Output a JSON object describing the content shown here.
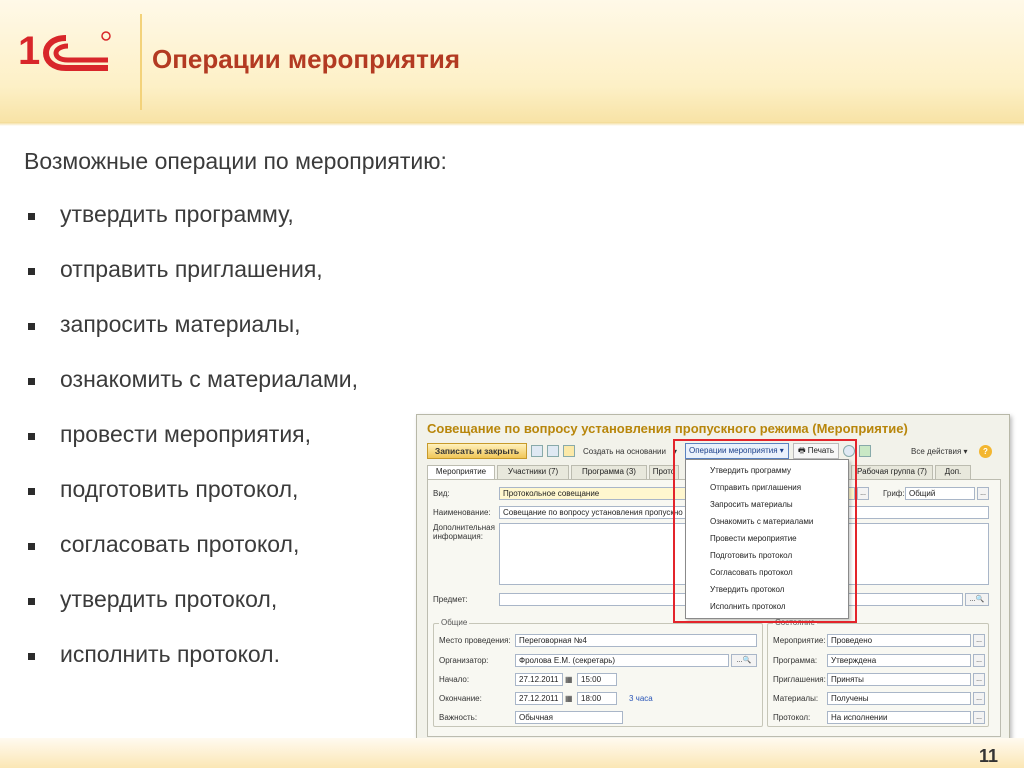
{
  "slide": {
    "logo_text": "1С",
    "title": "Операции мероприятия",
    "intro": "Возможные операции по мероприятию:",
    "bullets": [
      "утвердить программу,",
      "отправить приглашения,",
      "запросить материалы,",
      "ознакомить с материалами,",
      "провести мероприятия,",
      "подготовить протокол,",
      "согласовать протокол,",
      "утвердить протокол,",
      "исполнить протокол."
    ],
    "page_number": "11"
  },
  "screenshot": {
    "window_title": "Совещание по вопросу установления пропускного режима (Мероприятие)",
    "toolbar": {
      "save_close": "Записать и закрыть",
      "create_based": "Создать на основании",
      "operations": "Операции мероприятия",
      "print": "Печать",
      "all_actions": "Все действия",
      "help": "?"
    },
    "tabs": [
      "Мероприятие",
      "Участники (7)",
      "Программа (3)",
      "Прото",
      "Рабочая группа (7)",
      "Доп."
    ],
    "fields": {
      "kind_label": "Вид:",
      "kind_value": "Протокольное совещание",
      "name_label": "Наименование:",
      "name_value": "Совещание по вопросу установления пропускно",
      "extra_label": "Дополнительная информация:",
      "grif_label": "Гриф:",
      "grif_value": "Общий",
      "subject_label": "Предмет:"
    },
    "general": {
      "title": "Общие",
      "place_label": "Место проведения:",
      "place_value": "Переговорная №4",
      "organizer_label": "Организатор:",
      "organizer_value": "Фролова Е.М. (секретарь)",
      "start_label": "Начало:",
      "start_date": "27.12.2011",
      "start_time": "15:00",
      "end_label": "Окончание:",
      "end_date": "27.12.2011",
      "end_time": "18:00",
      "duration": "3 часа",
      "importance_label": "Важность:",
      "importance_value": "Обычная"
    },
    "state": {
      "title": "Состояние",
      "event_label": "Мероприятие:",
      "event_value": "Проведено",
      "program_label": "Программа:",
      "program_value": "Утверждена",
      "invites_label": "Приглашения:",
      "invites_value": "Приняты",
      "materials_label": "Материалы:",
      "materials_value": "Получены",
      "protocol_label": "Протокол:",
      "protocol_value": "На исполнении"
    },
    "dropdown": [
      "Утвердить программу",
      "Отправить приглашения",
      "Запросить материалы",
      "Ознакомить с материалами",
      "Провести мероприятие",
      "Подготовить протокол",
      "Согласовать протокол",
      "Утвердить протокол",
      "Исполнить протокол"
    ]
  }
}
